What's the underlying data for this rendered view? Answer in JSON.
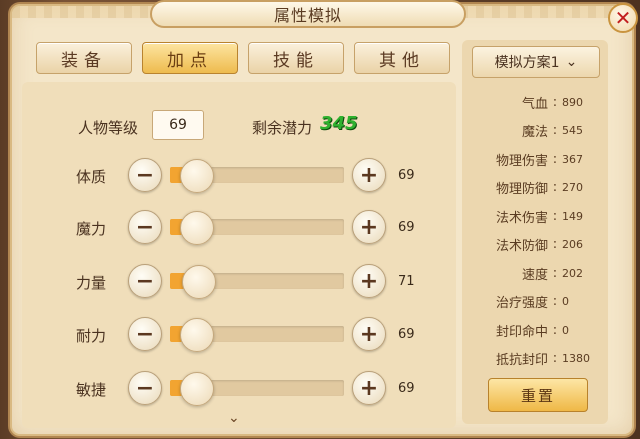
{
  "title": "属性模拟",
  "close_icon": "close-icon",
  "tabs": [
    {
      "label": "装备",
      "active": false
    },
    {
      "label": "加点",
      "active": true
    },
    {
      "label": "技能",
      "active": false
    },
    {
      "label": "其他",
      "active": false
    }
  ],
  "level": {
    "label": "人物等级",
    "value": "69"
  },
  "potential": {
    "label": "剩余潜力",
    "value": "345"
  },
  "stats": [
    {
      "name": "体质",
      "value": "69",
      "fill": 0.06
    },
    {
      "name": "魔力",
      "value": "69",
      "fill": 0.06
    },
    {
      "name": "力量",
      "value": "71",
      "fill": 0.07
    },
    {
      "name": "耐力",
      "value": "69",
      "fill": 0.06
    },
    {
      "name": "敏捷",
      "value": "69",
      "fill": 0.06
    }
  ],
  "buttons": {
    "minus": "−",
    "plus": "+"
  },
  "plan": {
    "label": "模拟方案1",
    "icon": "chevron-down-icon"
  },
  "attributes": [
    {
      "name": "气血",
      "value": "890"
    },
    {
      "name": "魔法",
      "value": "545"
    },
    {
      "name": "物理伤害",
      "value": "367"
    },
    {
      "name": "物理防御",
      "value": "270"
    },
    {
      "name": "法术伤害",
      "value": "149"
    },
    {
      "name": "法术防御",
      "value": "206"
    },
    {
      "name": "速度",
      "value": "202"
    },
    {
      "name": "治疗强度",
      "value": "0"
    },
    {
      "name": "封印命中",
      "value": "0"
    },
    {
      "name": "抵抗封印",
      "value": "1380"
    }
  ],
  "attr_sep": ":",
  "reset_label": "重置",
  "colors": {
    "accent": "#efb846",
    "potential": "#2fb12f",
    "fill": "#f2a431"
  }
}
